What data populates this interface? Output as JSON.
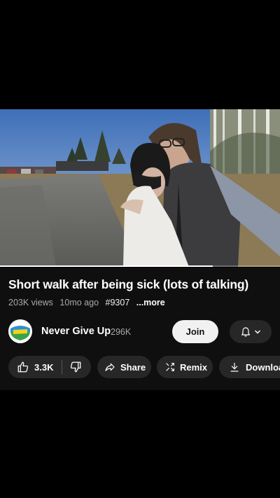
{
  "video": {
    "progress": 0.76
  },
  "details": {
    "title": "Short walk after being sick (lots of talking)",
    "views": "203K views",
    "age": "10mo ago",
    "hashtag": "#9307",
    "more": "...more"
  },
  "channel": {
    "name": "Never Give Up",
    "subscribers": "296K",
    "join_label": "Join"
  },
  "actions": {
    "likes": "3.3K",
    "share_label": "Share",
    "remix_label": "Remix",
    "download_label": "Download"
  },
  "icons": {
    "like": "thumbs-up-icon",
    "dislike": "thumbs-down-icon",
    "share": "share-arrow-icon",
    "remix": "remix-icon",
    "download": "download-icon",
    "bell": "bell-icon",
    "chevron": "chevron-down-icon"
  },
  "colors": {
    "background": "#000000",
    "panel": "#0f0f0f",
    "pill": "#272727",
    "join_button": "#f1f1f1",
    "secondary_text": "#aaaaaa"
  }
}
